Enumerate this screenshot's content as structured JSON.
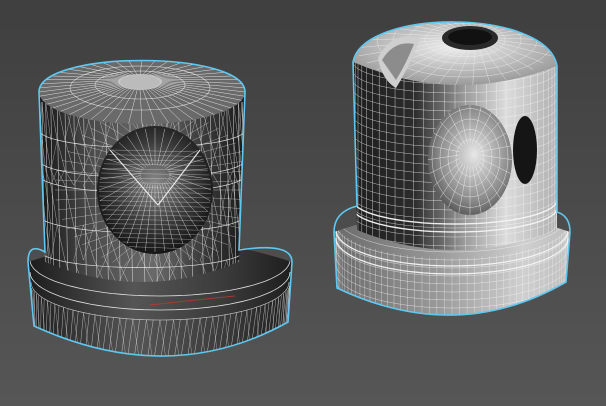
{
  "viewport": {
    "background_top": "#3f3f3f",
    "background_bottom": "#565656",
    "selection_outline_color": "#5fc8f0",
    "wire_color": "#f4f4f4",
    "surface_light": "#d8d8d8",
    "surface_dark": "#1a1a1a",
    "accent_edge_color": "#c0392b"
  },
  "objects": [
    {
      "name": "triangulated-mesh",
      "style": "triangulated wireframe",
      "selected": true
    },
    {
      "name": "quad-mesh",
      "style": "quad wireframe",
      "selected": true
    }
  ]
}
